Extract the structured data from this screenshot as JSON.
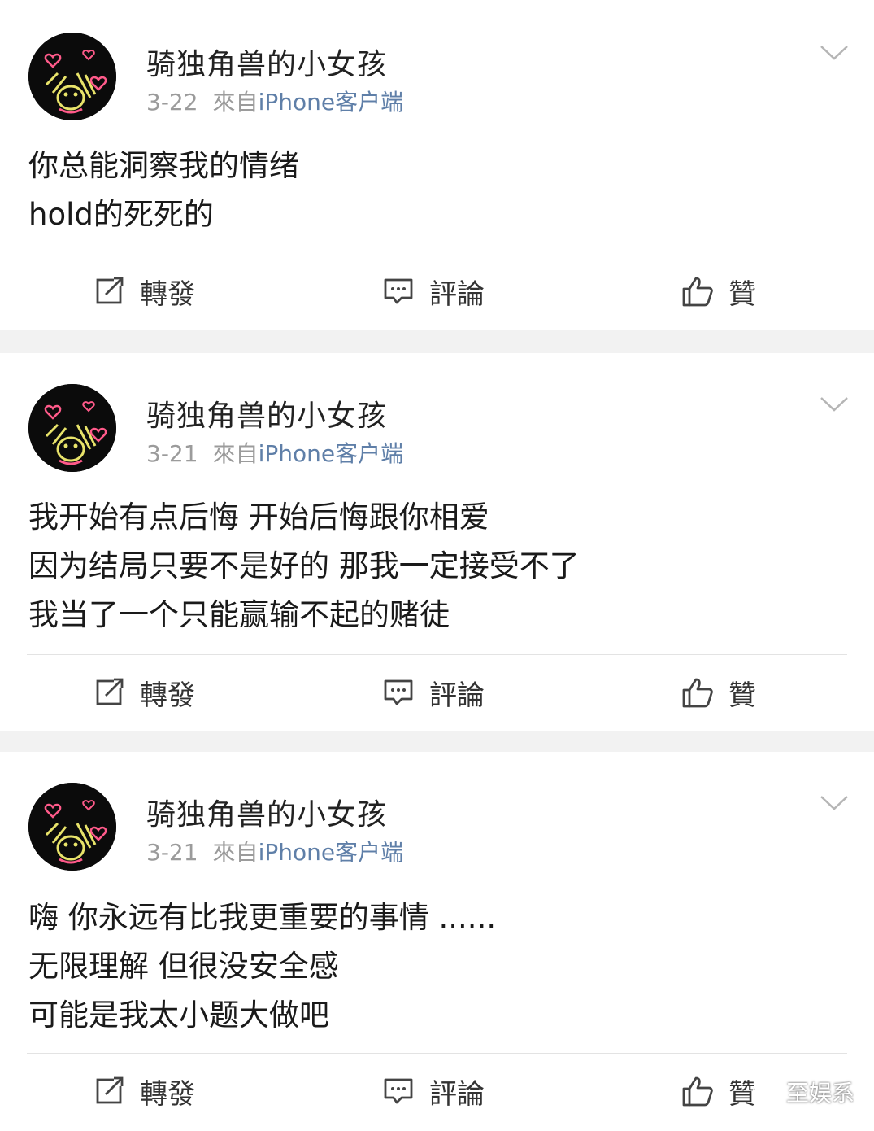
{
  "posts": [
    {
      "username": "骑独角兽的小女孩",
      "date": "3-22",
      "source_prefix": "來自",
      "source_client": "iPhone客户端",
      "lines": [
        "你总能洞察我的情绪",
        "hold的死死的"
      ],
      "actions": {
        "repost": "轉發",
        "comment": "評論",
        "like": "贊"
      }
    },
    {
      "username": "骑独角兽的小女孩",
      "date": "3-21",
      "source_prefix": "來自",
      "source_client": "iPhone客户端",
      "lines": [
        "我开始有点后悔 开始后悔跟你相爱",
        "因为结局只要不是好的 那我一定接受不了",
        "我当了一个只能赢输不起的赌徒"
      ],
      "actions": {
        "repost": "轉發",
        "comment": "評論",
        "like": "贊"
      }
    },
    {
      "username": "骑独角兽的小女孩",
      "date": "3-21",
      "source_prefix": "來自",
      "source_client": "iPhone客户端",
      "lines": [
        "嗨 你永远有比我更重要的事情 ......",
        "无限理解 但很没安全感",
        "可能是我太小题大做吧"
      ],
      "actions": {
        "repost": "轉發",
        "comment": "評論",
        "like": "贊"
      }
    }
  ],
  "watermark": {
    "text": "至娱系",
    "icon": "wechat-icon"
  },
  "icons": {
    "menu": "chevron-down-icon",
    "repost": "repost-icon",
    "comment": "comment-icon",
    "like": "thumbs-up-icon",
    "avatar": "neon-bear-hearts-avatar"
  },
  "colors": {
    "source_client": "#5f7fa8",
    "separator": "#f2f2f2",
    "avatar_bg": "#0b0b0b",
    "avatar_neon": "#e8e36a",
    "avatar_hearts": "#ff5a8a"
  }
}
